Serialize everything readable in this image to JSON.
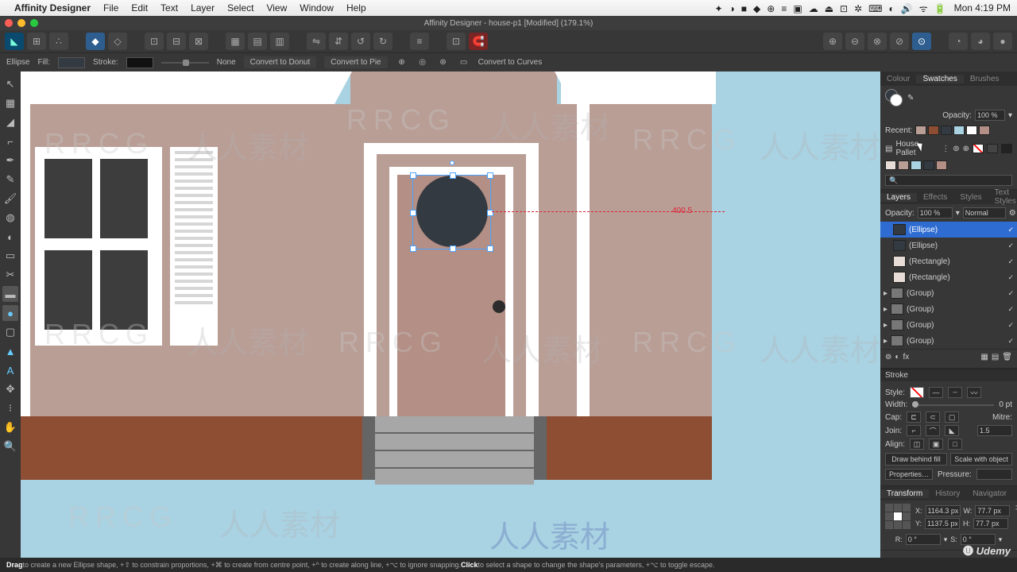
{
  "menubar": {
    "app": "Affinity Designer",
    "items": [
      "File",
      "Edit",
      "Text",
      "Layer",
      "Select",
      "View",
      "Window",
      "Help"
    ],
    "clock": "Mon 4:19 PM"
  },
  "titlebar": {
    "text": "Affinity Designer - house-p1 [Modified] (179.1%)"
  },
  "contextbar": {
    "tool": "Ellipse",
    "fill_label": "Fill:",
    "stroke_label": "Stroke:",
    "stroke_width": "None",
    "donut": "Convert to Donut",
    "pie": "Convert to Pie",
    "curves": "Convert to Curves"
  },
  "canvas": {
    "align_readout": "400.5"
  },
  "swatches": {
    "tabs": [
      "Colour",
      "Swatches",
      "Brushes"
    ],
    "opacity_label": "Opacity:",
    "opacity_value": "100 %",
    "recent_label": "Recent:",
    "palette_name": "House Pallet",
    "recent_colors": [
      "#b99e96",
      "#8e4e33",
      "#343a42",
      "#a9d2e2",
      "#ffffff",
      "#b38f85"
    ],
    "palette_colors": [
      "#e8dcd6",
      "#b99e96",
      "#a9d2e2",
      "#343a42",
      "#b38f85"
    ]
  },
  "layers": {
    "tabs": [
      "Layers",
      "Effects",
      "Styles",
      "Text Styles"
    ],
    "opacity_label": "Opacity:",
    "opacity_value": "100 %",
    "blend": "Normal",
    "items": [
      {
        "name": "(Ellipse)",
        "sel": true,
        "thumb": "#343a42"
      },
      {
        "name": "(Ellipse)",
        "thumb": "#343a42"
      },
      {
        "name": "(Rectangle)",
        "thumb": "#e8dcd6"
      },
      {
        "name": "(Rectangle)",
        "thumb": "#e8dcd6"
      },
      {
        "name": "(Group)",
        "thumb": "#777",
        "arrow": true
      },
      {
        "name": "(Group)",
        "thumb": "#777",
        "arrow": true
      },
      {
        "name": "(Group)",
        "thumb": "#777",
        "arrow": true
      },
      {
        "name": "(Group)",
        "thumb": "#777",
        "arrow": true
      }
    ]
  },
  "stroke": {
    "title": "Stroke",
    "style_label": "Style:",
    "width_label": "Width:",
    "width_value": "0 pt",
    "cap_label": "Cap:",
    "join_label": "Join:",
    "align_label": "Align:",
    "mitre_label": "Mitre:",
    "mitre_value": "1.5",
    "draw_behind": "Draw behind fill",
    "scale_obj": "Scale with object",
    "properties": "Properties…",
    "pressure": "Pressure:"
  },
  "transform": {
    "tabs": [
      "Transform",
      "History",
      "Navigator"
    ],
    "x_label": "X:",
    "x": "1164.3 px",
    "y_label": "Y:",
    "y": "1137.5 px",
    "w_label": "W:",
    "w": "77.7 px",
    "h_label": "H:",
    "h": "77.7 px",
    "r_label": "R:",
    "r": "0 °",
    "s_label": "S:",
    "s": "0 °"
  },
  "statusbar": {
    "text1": "Drag",
    "text1b": " to create a new Ellipse shape, +⇧ to constrain proportions, +⌘ to create from centre point, +^ to create along line, +⌥ to ignore snapping. ",
    "text2": "Click",
    "text2b": " to select a shape to change the shape's parameters, +⌥ to toggle escape."
  },
  "branding": {
    "udemy": "Udemy"
  }
}
